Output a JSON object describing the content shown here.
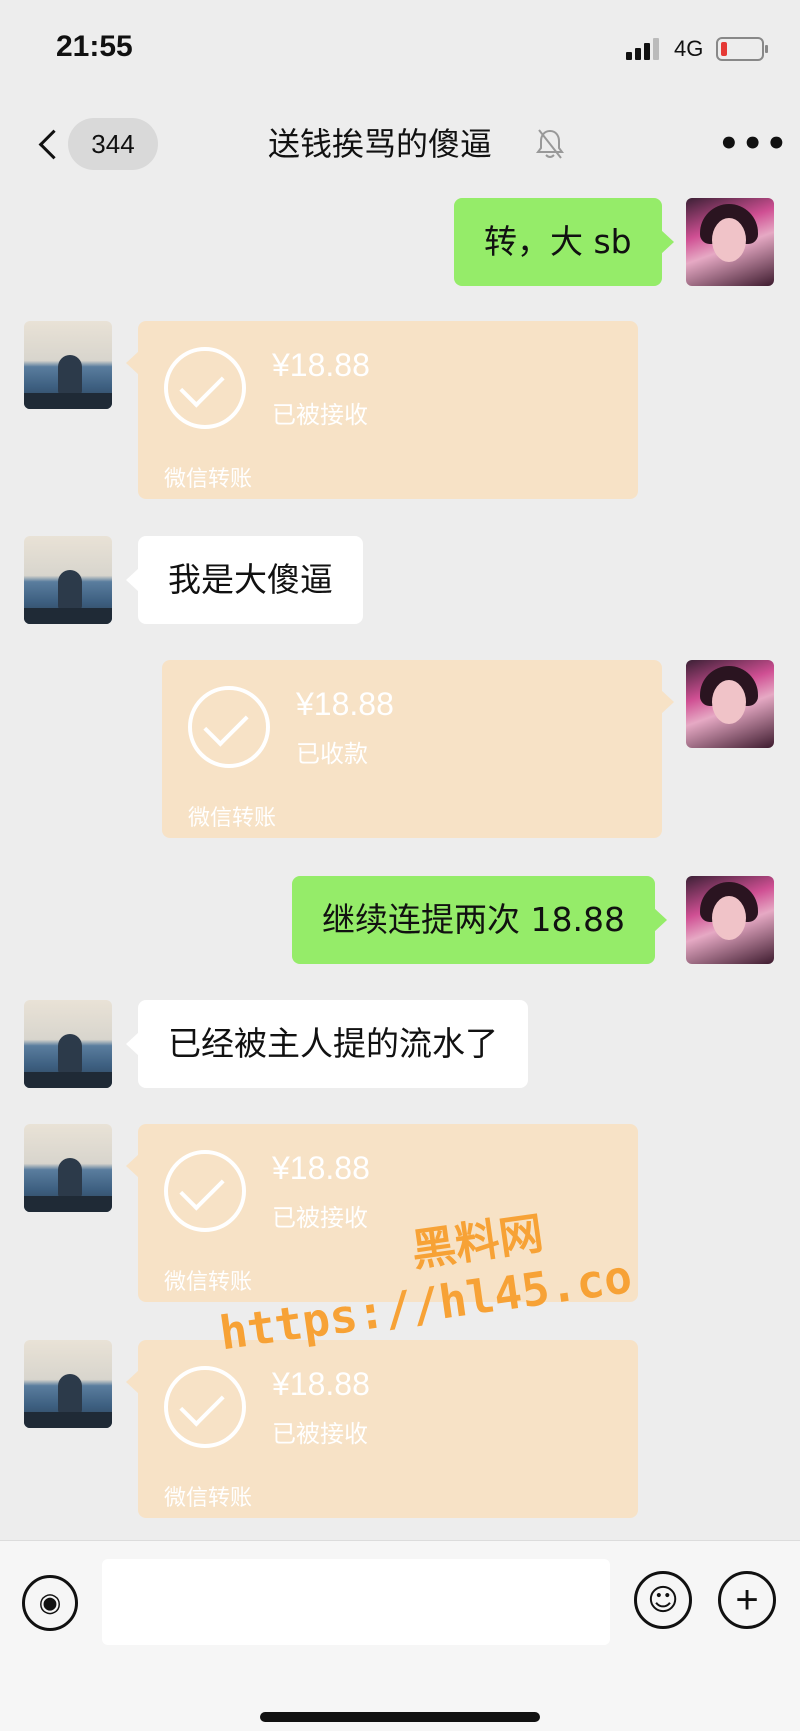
{
  "status_bar": {
    "time": "21:55",
    "network": "4G"
  },
  "header": {
    "back_count": "344",
    "title": "送钱挨骂的傻逼",
    "more": "•••"
  },
  "messages": [
    {
      "type": "text",
      "side": "right",
      "text": "转，大 sb"
    },
    {
      "type": "transfer",
      "side": "left",
      "amount": "¥18.88",
      "status": "已被接收",
      "footer": "微信转账"
    },
    {
      "type": "text",
      "side": "left",
      "text": "我是大傻逼"
    },
    {
      "type": "transfer",
      "side": "right",
      "amount": "¥18.88",
      "status": "已收款",
      "footer": "微信转账"
    },
    {
      "type": "text",
      "side": "right",
      "text": "继续连提两次 18.88"
    },
    {
      "type": "text",
      "side": "left",
      "text": "已经被主人提的流水了"
    },
    {
      "type": "transfer",
      "side": "left",
      "amount": "¥18.88",
      "status": "已被接收",
      "footer": "微信转账"
    },
    {
      "type": "transfer",
      "side": "left",
      "amount": "¥18.88",
      "status": "已被接收",
      "footer": "微信转账"
    }
  ],
  "watermark": {
    "line1": "黑料网",
    "line2": "https://hl45.co"
  },
  "input_bar": {
    "placeholder": "",
    "voice_icon": "voice-icon",
    "emoji_icon": "emoji-icon",
    "plus_icon": "plus-icon"
  },
  "colors": {
    "sent_bubble": "#95ec69",
    "received_bubble": "#ffffff",
    "transfer_card": "#f7e2c6",
    "watermark": "#f7a236",
    "background": "#ededed"
  }
}
